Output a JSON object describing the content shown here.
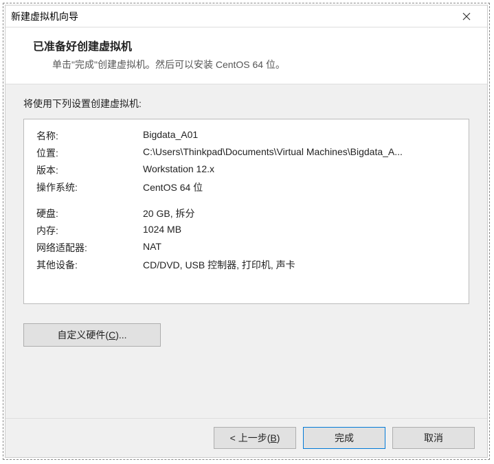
{
  "window": {
    "title": "新建虚拟机向导"
  },
  "header": {
    "title": "已准备好创建虚拟机",
    "subtitle": "单击\"完成\"创建虚拟机。然后可以安装 CentOS 64 位。"
  },
  "settings": {
    "intro": "将使用下列设置创建虚拟机:",
    "rows": [
      {
        "label": "名称:",
        "value": "Bigdata_A01"
      },
      {
        "label": "位置:",
        "value": "C:\\Users\\Thinkpad\\Documents\\Virtual Machines\\Bigdata_A..."
      },
      {
        "label": "版本:",
        "value": "Workstation 12.x"
      },
      {
        "label": "操作系统:",
        "value": "CentOS 64 位"
      }
    ],
    "rows2": [
      {
        "label": "硬盘:",
        "value": "20 GB, 拆分"
      },
      {
        "label": "内存:",
        "value": "1024 MB"
      },
      {
        "label": "网络适配器:",
        "value": "NAT"
      },
      {
        "label": "其他设备:",
        "value": "CD/DVD, USB 控制器, 打印机, 声卡"
      }
    ]
  },
  "buttons": {
    "customize_pre": "自定义硬件(",
    "customize_u": "C",
    "customize_post": ")...",
    "back_pre": "< 上一步(",
    "back_u": "B",
    "back_post": ")",
    "finish": "完成",
    "cancel": "取消"
  }
}
